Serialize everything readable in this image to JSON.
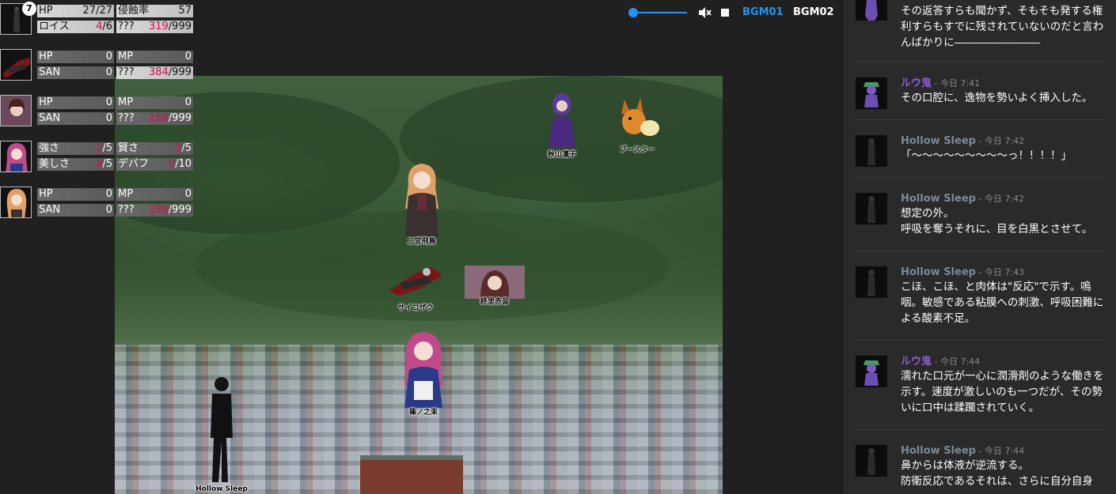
{
  "status_sheets": [
    {
      "badge": "7",
      "rows": [
        [
          {
            "label": "HP",
            "value": "27/27",
            "style": "hi"
          },
          {
            "label": "侵蝕率",
            "value": "57",
            "style": "hi"
          }
        ],
        [
          {
            "label": "ロイス",
            "value_red": "4",
            "value_rest": "/6",
            "style": "hi"
          },
          {
            "label": "???",
            "value_red": "319",
            "value_rest": "/999",
            "style": "hi"
          }
        ]
      ]
    },
    {
      "rows": [
        [
          {
            "label": "HP",
            "value": "0"
          },
          {
            "label": "MP",
            "value": "0"
          }
        ],
        [
          {
            "label": "SAN",
            "value": "0"
          },
          {
            "label": "???",
            "value_red": "384",
            "value_rest": "/999",
            "style": "hi"
          }
        ]
      ]
    },
    {
      "rows": [
        [
          {
            "label": "HP",
            "value": "0"
          },
          {
            "label": "MP",
            "value": "0"
          }
        ],
        [
          {
            "label": "SAN",
            "value": "0"
          },
          {
            "label": "???",
            "value_red": "158",
            "value_rest": "/999"
          }
        ]
      ]
    },
    {
      "rows": [
        [
          {
            "label": "強さ",
            "value_red": "1",
            "value_rest": "/5"
          },
          {
            "label": "賢さ",
            "value_red": "1",
            "value_rest": "/5"
          }
        ],
        [
          {
            "label": "美しさ",
            "value_red": "2",
            "value_rest": "/5"
          },
          {
            "label": "デバフ",
            "value_red": "0",
            "value_rest": "/10"
          }
        ]
      ]
    },
    {
      "rows": [
        [
          {
            "label": "HP",
            "value": "0"
          },
          {
            "label": "MP",
            "value": "0"
          }
        ],
        [
          {
            "label": "SAN",
            "value": "0"
          },
          {
            "label": "???",
            "value_red": "183",
            "value_rest": "/999"
          }
        ]
      ]
    }
  ],
  "audio": {
    "bgm_tracks": [
      {
        "label": "BGM01",
        "active": true
      },
      {
        "label": "BGM02",
        "active": false
      }
    ],
    "mute_icon": "volume-off-icon",
    "stop_icon": "stop-icon",
    "volume": 0.05
  },
  "map_tokens": [
    {
      "name": "秋山凛子",
      "color": "#5a3a9a"
    },
    {
      "name": "ブースター",
      "color": "#e08a30"
    },
    {
      "name": "二宮飛鳥",
      "color": "#3a3030"
    },
    {
      "name": "サイコザク",
      "color": "#8a1a1a"
    },
    {
      "name": "終里赤音",
      "color": "#8a6a7a"
    },
    {
      "name": "篠ノ之束",
      "color": "#c04a8a"
    },
    {
      "name": "Hollow Sleep",
      "color": "#111111"
    }
  ],
  "chat": [
    {
      "name": "",
      "time": "",
      "color": "#8a6fd0",
      "avatar": "purple",
      "text": "その返答すらも聞かず、そもそも発する権利すらもすでに残されていないのだと言わんばかりに――――――――"
    },
    {
      "name": "ルウ鬼",
      "time": "今日 7:41",
      "color": "#8a5fd0",
      "avatar": "purple",
      "text": "その口腔に、逸物を勢いよく挿入した。"
    },
    {
      "name": "Hollow Sleep",
      "time": "今日 7:42",
      "color": "#7d8a96",
      "avatar": "dark",
      "text": "「〜〜〜〜〜〜〜〜〜っ！！！！」"
    },
    {
      "name": "Hollow Sleep",
      "time": "今日 7:42",
      "color": "#7d8a96",
      "avatar": "dark",
      "text": "想定の外。\n呼吸を奪うそれに、目を白黒とさせて。"
    },
    {
      "name": "Hollow Sleep",
      "time": "今日 7:43",
      "color": "#7d8a96",
      "avatar": "dark",
      "text": "こほ、こほ、と肉体は\"反応\"で示す。嗚咽。敏感である粘膜への刺激、呼吸困難による酸素不足。"
    },
    {
      "name": "ルウ鬼",
      "time": "今日 7:44",
      "color": "#8a5fd0",
      "avatar": "purple",
      "text": "濡れた口元が一心に潤滑剤のような働きを示す。速度が激しいのも一つだが、その勢いに口中は蹂躙されていく。"
    },
    {
      "name": "Hollow Sleep",
      "time": "今日 7:44",
      "color": "#7d8a96",
      "avatar": "dark",
      "text": "鼻からは体液が逆流する。\n防衛反応であるそれは、さらに自分自身"
    }
  ]
}
